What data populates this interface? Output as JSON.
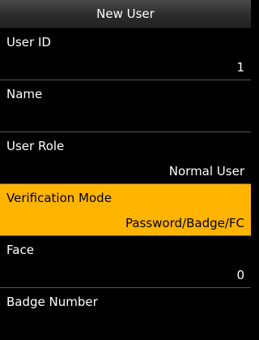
{
  "title": "New User",
  "colors": {
    "background": "#000000",
    "highlight": "#ffb400",
    "divider": "#555555",
    "text": "#ffffff",
    "selected_text": "#000000"
  },
  "fields": [
    {
      "label": "User ID",
      "value": "1",
      "selected": false
    },
    {
      "label": "Name",
      "value": "",
      "selected": false
    },
    {
      "label": "User Role",
      "value": "Normal User",
      "selected": false
    },
    {
      "label": "Verification Mode",
      "value": "Password/Badge/FC",
      "selected": true
    },
    {
      "label": "Face",
      "value": "0",
      "selected": false
    },
    {
      "label": "Badge Number",
      "value": "",
      "selected": false
    }
  ]
}
